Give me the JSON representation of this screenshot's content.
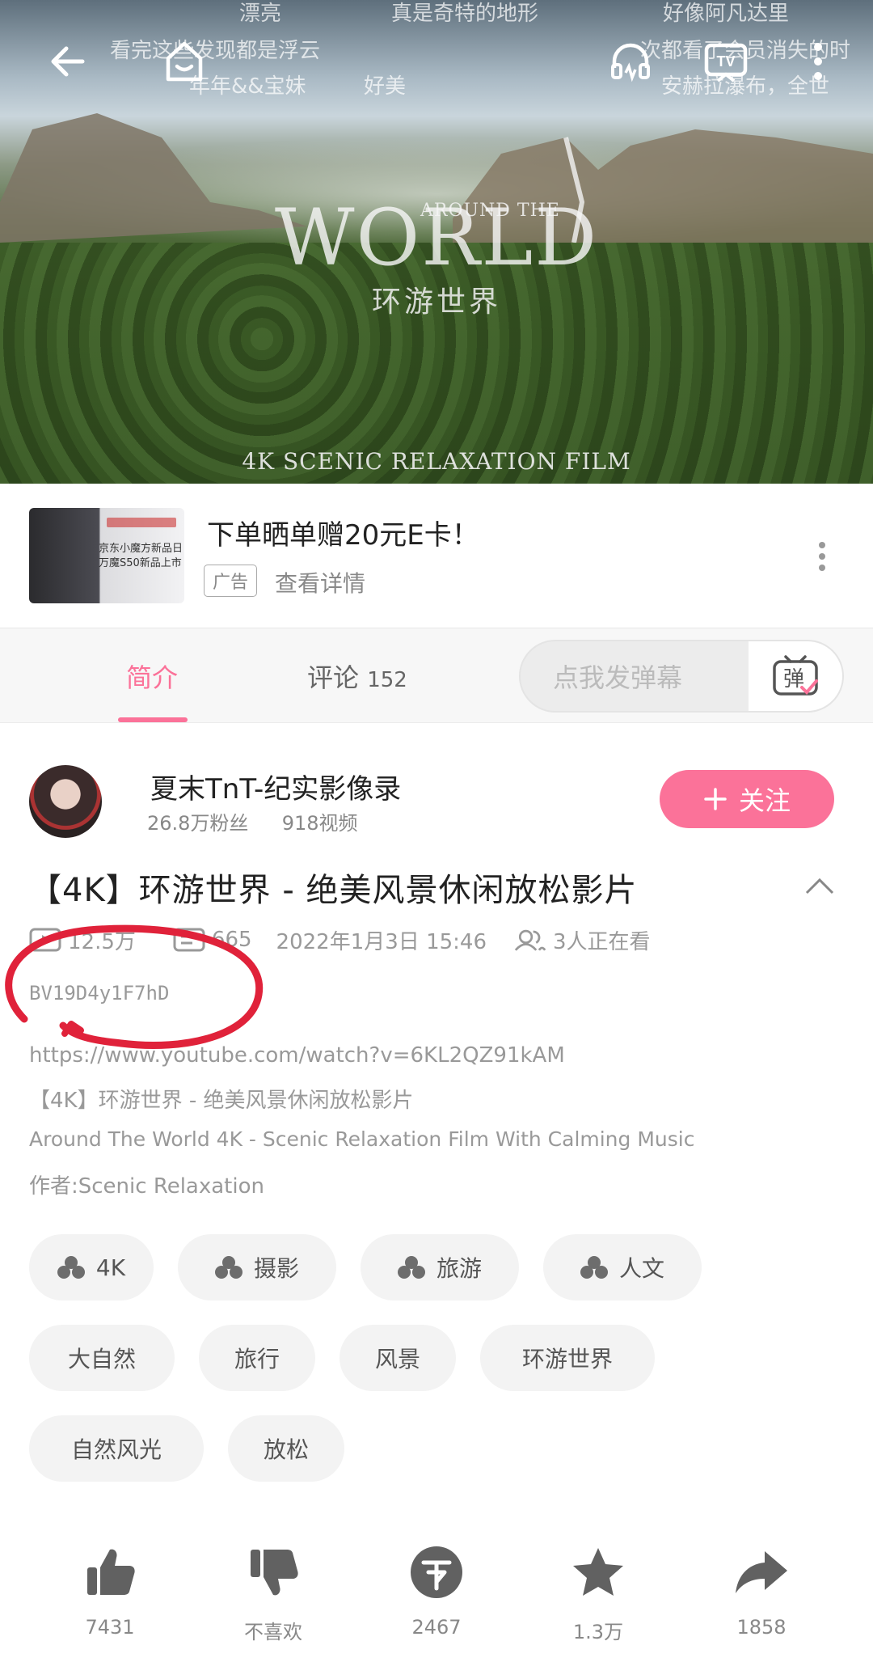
{
  "player": {
    "title_top": "AROUND THE",
    "title_main": "WORLD",
    "title_cn": "环游世界",
    "title_foot": "4K SCENIC RELAXATION FILM",
    "danmaku": [
      "漂亮",
      "真是奇特的地形",
      "好像阿凡达里",
      "看完这些发现都是浮云",
      "次都看了会员消失的时",
      "年年&&宝妹",
      "好美",
      "安赫拉瀑布，全世"
    ]
  },
  "ad": {
    "title": "下单晒单赠20元E卡！",
    "tag": "广告",
    "detail": "查看详情",
    "thumb_text_1": "京东小魔方新品日",
    "thumb_text_2": "万魔S50新品上市"
  },
  "tabs": {
    "intro": "简介",
    "comments_label": "评论",
    "comments_count": "152",
    "danmu_placeholder": "点我发弹幕",
    "danmu_icon_char": "弹"
  },
  "uploader": {
    "name": "夏末TnT-纪实影像录",
    "fans": "26.8万粉丝",
    "videos": "918视频",
    "follow": "关注"
  },
  "video": {
    "title": "【4K】环游世界 - 绝美风景休闲放松影片",
    "plays": "12.5万",
    "danmaku_count": "665",
    "date": "2022年1月3日 15:46",
    "watching": "3人正在看",
    "bvid": "BV19D4y1F7hD",
    "desc_lines": [
      "https://www.youtube.com/watch?v=6KL2QZ91kAM",
      "【4K】环游世界 - 绝美风景休闲放松影片",
      "Around The World 4K - Scenic Relaxation Film With Calming Music",
      "作者:Scenic Relaxation"
    ]
  },
  "tags": [
    "4K",
    "摄影",
    "旅游",
    "人文",
    "大自然",
    "旅行",
    "风景",
    "环游世界",
    "自然风光",
    "放松"
  ],
  "actions": {
    "like": "7431",
    "dislike": "不喜欢",
    "coin": "2467",
    "favorite": "1.3万",
    "share": "1858"
  },
  "colors": {
    "accent": "#fb7299",
    "annotation": "#e0223a",
    "icon": "#616161"
  }
}
